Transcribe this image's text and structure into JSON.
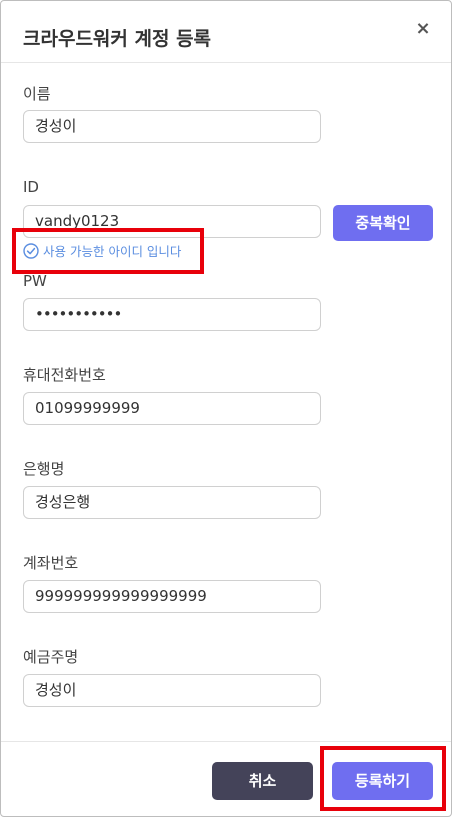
{
  "dialog": {
    "title": "크라우드워커 계정 등록",
    "close_label": "×"
  },
  "form": {
    "name": {
      "label": "이름",
      "value": "경성이"
    },
    "id": {
      "label": "ID",
      "value": "vandy0123",
      "check_button_label": "중복확인",
      "status_message": "사용 가능한 아이디 입니다"
    },
    "password": {
      "label": "PW",
      "value": "•••••••••••"
    },
    "phone": {
      "label": "휴대전화번호",
      "value": "01099999999"
    },
    "bank": {
      "label": "은행명",
      "value": "경성은행"
    },
    "account_number": {
      "label": "계좌번호",
      "value": "999999999999999999"
    },
    "account_holder": {
      "label": "예금주명",
      "value": "경성이"
    }
  },
  "footer": {
    "cancel_label": "취소",
    "submit_label": "등록하기"
  },
  "colors": {
    "accent": "#6f6ef0",
    "dark_button": "#444359",
    "success_text": "#5b8ee0",
    "highlight": "#e8000a"
  }
}
